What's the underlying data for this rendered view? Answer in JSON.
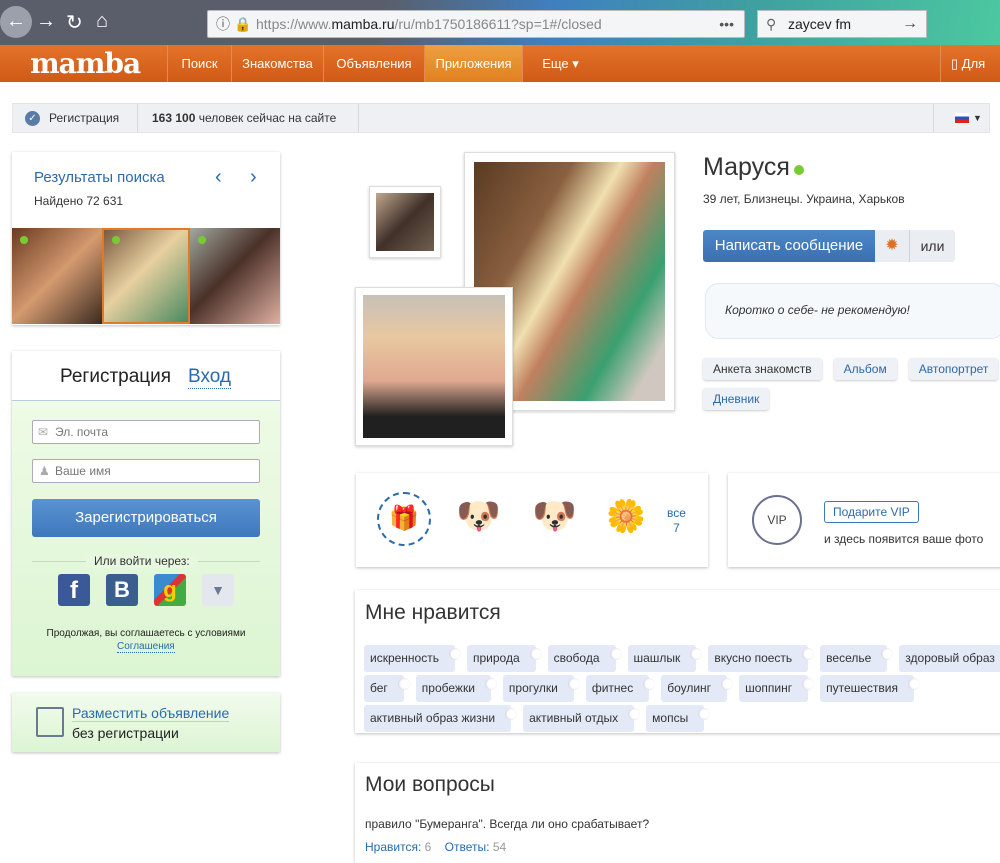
{
  "browser": {
    "url_prefix": "https://www.",
    "url_domain": "mamba.ru",
    "url_path": "/ru/mb1750186611?sp=1#/closed",
    "search_value": "zaycev fm"
  },
  "nav": {
    "logo": "mamba",
    "items": [
      "Поиск",
      "Знакомства",
      "Объявления",
      "Приложения",
      "Еще ▾"
    ],
    "mobile": "Для"
  },
  "status": {
    "register": "Регистрация",
    "online_count": "163 100",
    "online_text": "человек сейчас на сайте"
  },
  "search_results": {
    "title": "Результаты поиска",
    "found": "Найдено 72 631"
  },
  "auth": {
    "tab_register": "Регистрация",
    "tab_login": "Вход",
    "email_placeholder": "Эл. почта",
    "name_placeholder": "Ваше имя",
    "submit": "Зарегистрироваться",
    "or_via": "Или войти через:",
    "terms": "Продолжая, вы соглашаетесь с условиями",
    "terms_link": "Соглашения"
  },
  "ad": {
    "link": "Разместить объявление",
    "sub": "без регистрации"
  },
  "profile": {
    "name": "Маруся",
    "info": "39 лет, Близнецы. Украина, Харьков",
    "message_btn": "Написать сообщение",
    "or": "или",
    "about": "Коротко о себе- не рекомендую!",
    "tabs": [
      "Анкета знакомств",
      "Альбом",
      "Автопортрет",
      "Дневник"
    ]
  },
  "gifts": {
    "all": "все",
    "count": "7"
  },
  "vip": {
    "button": "Подарите VIP",
    "text": "и здесь появится ваше фото",
    "badge": "VIP"
  },
  "likes": {
    "title": "Мне нравится",
    "rows": [
      [
        "искренность",
        "природа",
        "свобода",
        "шашлык",
        "вкусно поесть",
        "веселье",
        "здоровый образ"
      ],
      [
        "бег",
        "пробежки",
        "прогулки",
        "фитнес",
        "боулинг",
        "шоппинг",
        "путешествия"
      ],
      [
        "активный образ жизни",
        "активный отдых",
        "мопсы"
      ]
    ]
  },
  "questions": {
    "title": "Мои вопросы",
    "question": "правило \"Бумеранга\". Всегда ли оно срабатывает?",
    "likes_label": "Нравится:",
    "likes": "6",
    "answers_label": "Ответы:",
    "answers": "54"
  }
}
